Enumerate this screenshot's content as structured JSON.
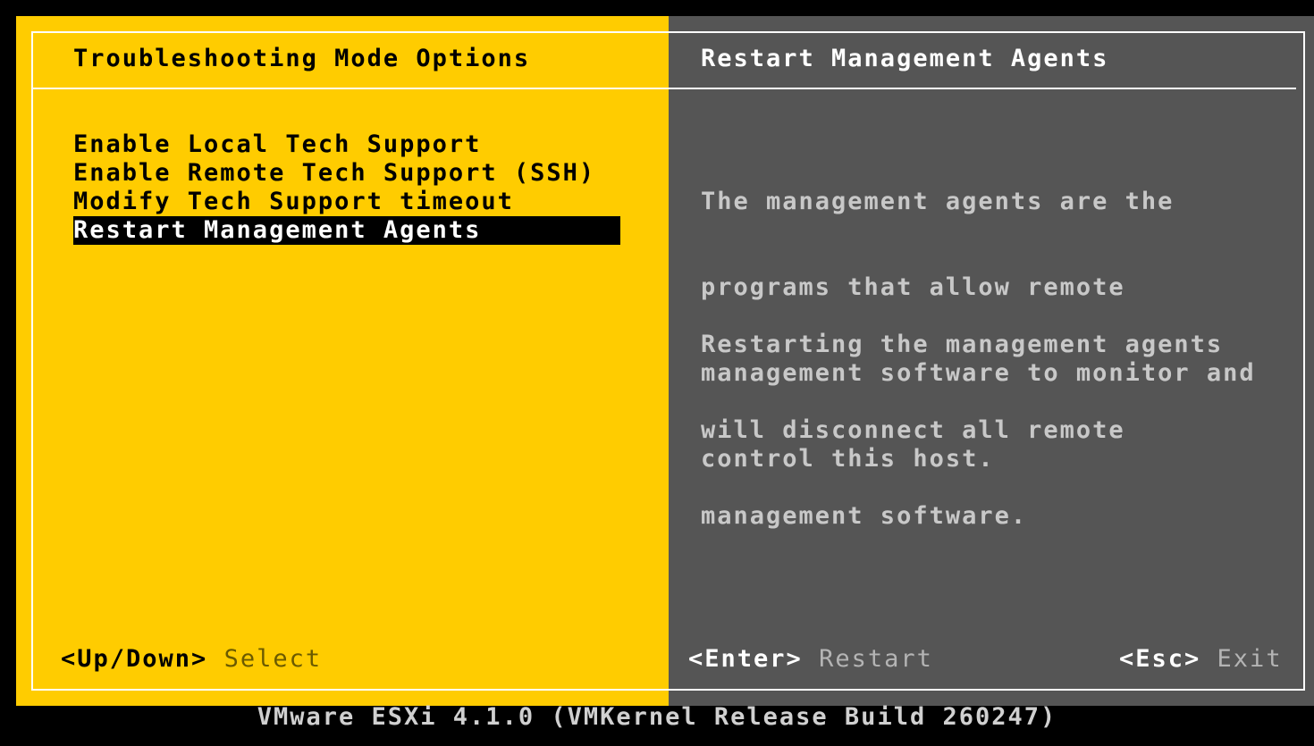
{
  "left_panel": {
    "title": "Troubleshooting Mode Options",
    "menu_items": [
      {
        "label": "Enable Local Tech Support",
        "selected": false
      },
      {
        "label": "Enable Remote Tech Support (SSH)",
        "selected": false
      },
      {
        "label": "Modify Tech Support timeout",
        "selected": false
      },
      {
        "label": "Restart Management Agents",
        "selected": true
      }
    ],
    "hint": {
      "key": "<Up/Down>",
      "action": "Select"
    }
  },
  "right_panel": {
    "title": "Restart Management Agents",
    "description_1": [
      "The management agents are the",
      "programs that allow remote",
      "management software to monitor and",
      "control this host."
    ],
    "description_2": [
      "Restarting the management agents",
      "will disconnect all remote",
      "management software."
    ],
    "hint_enter": {
      "key": "<Enter>",
      "action": "Restart"
    },
    "hint_esc": {
      "key": "<Esc>",
      "action": "Exit"
    }
  },
  "footer": "VMware ESXi 4.1.0 (VMKernel Release Build 260247)",
  "colors": {
    "left_panel_bg": "#ffcc00",
    "right_panel_bg": "#555555",
    "selection_bg": "#000000",
    "screen_bg": "#000000"
  }
}
